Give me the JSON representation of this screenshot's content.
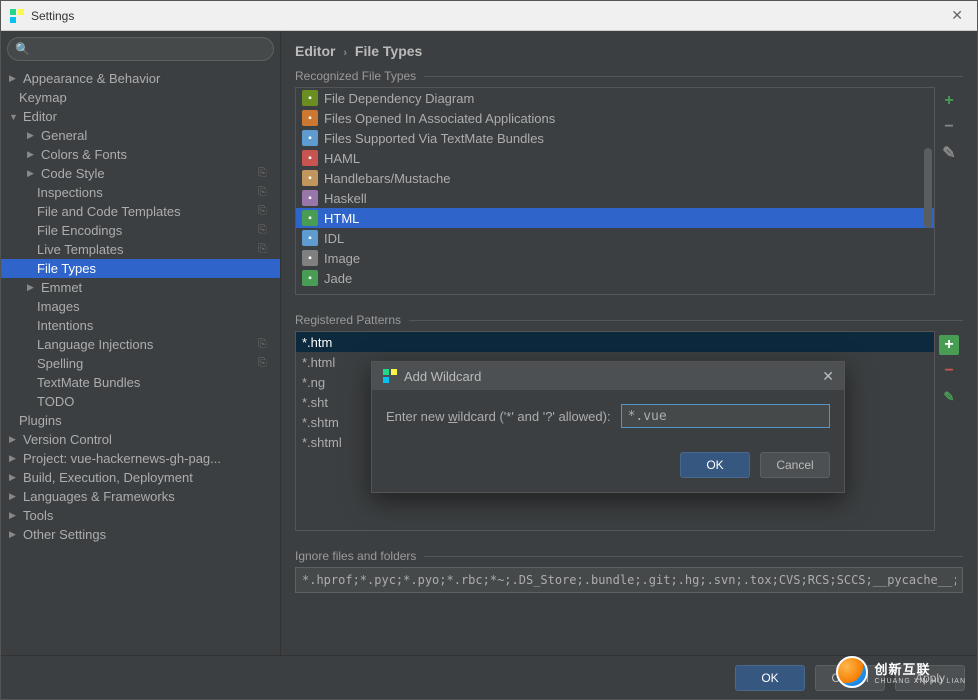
{
  "window": {
    "title": "Settings"
  },
  "search": {
    "placeholder": ""
  },
  "tree": [
    {
      "label": "Appearance & Behavior",
      "indent": 0,
      "expandable": true,
      "expanded": false
    },
    {
      "label": "Keymap",
      "indent": 0,
      "expandable": false
    },
    {
      "label": "Editor",
      "indent": 0,
      "expandable": true,
      "expanded": true
    },
    {
      "label": "General",
      "indent": 1,
      "expandable": true,
      "expanded": false
    },
    {
      "label": "Colors & Fonts",
      "indent": 1,
      "expandable": true,
      "expanded": false
    },
    {
      "label": "Code Style",
      "indent": 1,
      "expandable": true,
      "expanded": false,
      "copy": true
    },
    {
      "label": "Inspections",
      "indent": 1,
      "expandable": false,
      "copy": true
    },
    {
      "label": "File and Code Templates",
      "indent": 1,
      "expandable": false,
      "copy": true
    },
    {
      "label": "File Encodings",
      "indent": 1,
      "expandable": false,
      "copy": true
    },
    {
      "label": "Live Templates",
      "indent": 1,
      "expandable": false,
      "copy": true
    },
    {
      "label": "File Types",
      "indent": 1,
      "expandable": false,
      "selected": true
    },
    {
      "label": "Emmet",
      "indent": 1,
      "expandable": true,
      "expanded": false
    },
    {
      "label": "Images",
      "indent": 1,
      "expandable": false
    },
    {
      "label": "Intentions",
      "indent": 1,
      "expandable": false
    },
    {
      "label": "Language Injections",
      "indent": 1,
      "expandable": false,
      "copy": true
    },
    {
      "label": "Spelling",
      "indent": 1,
      "expandable": false,
      "copy": true
    },
    {
      "label": "TextMate Bundles",
      "indent": 1,
      "expandable": false
    },
    {
      "label": "TODO",
      "indent": 1,
      "expandable": false
    },
    {
      "label": "Plugins",
      "indent": 0,
      "expandable": false
    },
    {
      "label": "Version Control",
      "indent": 0,
      "expandable": true,
      "expanded": false
    },
    {
      "label": "Project: vue-hackernews-gh-pag...",
      "indent": 0,
      "expandable": true,
      "expanded": false
    },
    {
      "label": "Build, Execution, Deployment",
      "indent": 0,
      "expandable": true,
      "expanded": false
    },
    {
      "label": "Languages & Frameworks",
      "indent": 0,
      "expandable": true,
      "expanded": false
    },
    {
      "label": "Tools",
      "indent": 0,
      "expandable": true,
      "expanded": false
    },
    {
      "label": "Other Settings",
      "indent": 0,
      "expandable": true,
      "expanded": false
    }
  ],
  "breadcrumb": {
    "a": "Editor",
    "b": "File Types"
  },
  "section1": {
    "label": "Recognized File Types"
  },
  "fileTypes": [
    {
      "label": "File Dependency Diagram",
      "iconColor": "#6b8e23"
    },
    {
      "label": "Files Opened In Associated Applications",
      "iconColor": "#cc7832"
    },
    {
      "label": "Files Supported Via TextMate Bundles",
      "iconColor": "#5e9bcf"
    },
    {
      "label": "HAML",
      "iconColor": "#c75450"
    },
    {
      "label": "Handlebars/Mustache",
      "iconColor": "#c0965c"
    },
    {
      "label": "Haskell",
      "iconColor": "#9876aa"
    },
    {
      "label": "HTML",
      "iconColor": "#499c54",
      "selected": true
    },
    {
      "label": "IDL",
      "iconColor": "#5e9bcf"
    },
    {
      "label": "Image",
      "iconColor": "#808080"
    },
    {
      "label": "Jade",
      "iconColor": "#499c54"
    }
  ],
  "section2": {
    "label": "Registered Patterns"
  },
  "patterns": [
    {
      "label": "*.htm",
      "selected": true
    },
    {
      "label": "*.html"
    },
    {
      "label": "*.ng"
    },
    {
      "label": "*.sht"
    },
    {
      "label": "*.shtm"
    },
    {
      "label": "*.shtml"
    }
  ],
  "ignore": {
    "label": "Ignore files and folders",
    "value": "*.hprof;*.pyc;*.pyo;*.rbc;*~;.DS_Store;.bundle;.git;.hg;.svn;.tox;CVS;RCS;SCCS;__pycache__;_sv"
  },
  "buttons": {
    "ok": "OK",
    "cancel": "Cancel",
    "apply": "Apply"
  },
  "dialog": {
    "title": "Add Wildcard",
    "prompt_pre": "Enter new ",
    "prompt_u": "w",
    "prompt_post": "ildcard ('*' and '?' allowed):",
    "value": "*.vue",
    "ok": "OK",
    "cancel": "Cancel"
  },
  "brand": {
    "cn": "创新互联",
    "en": "CHUANG XIN HU LIAN"
  }
}
